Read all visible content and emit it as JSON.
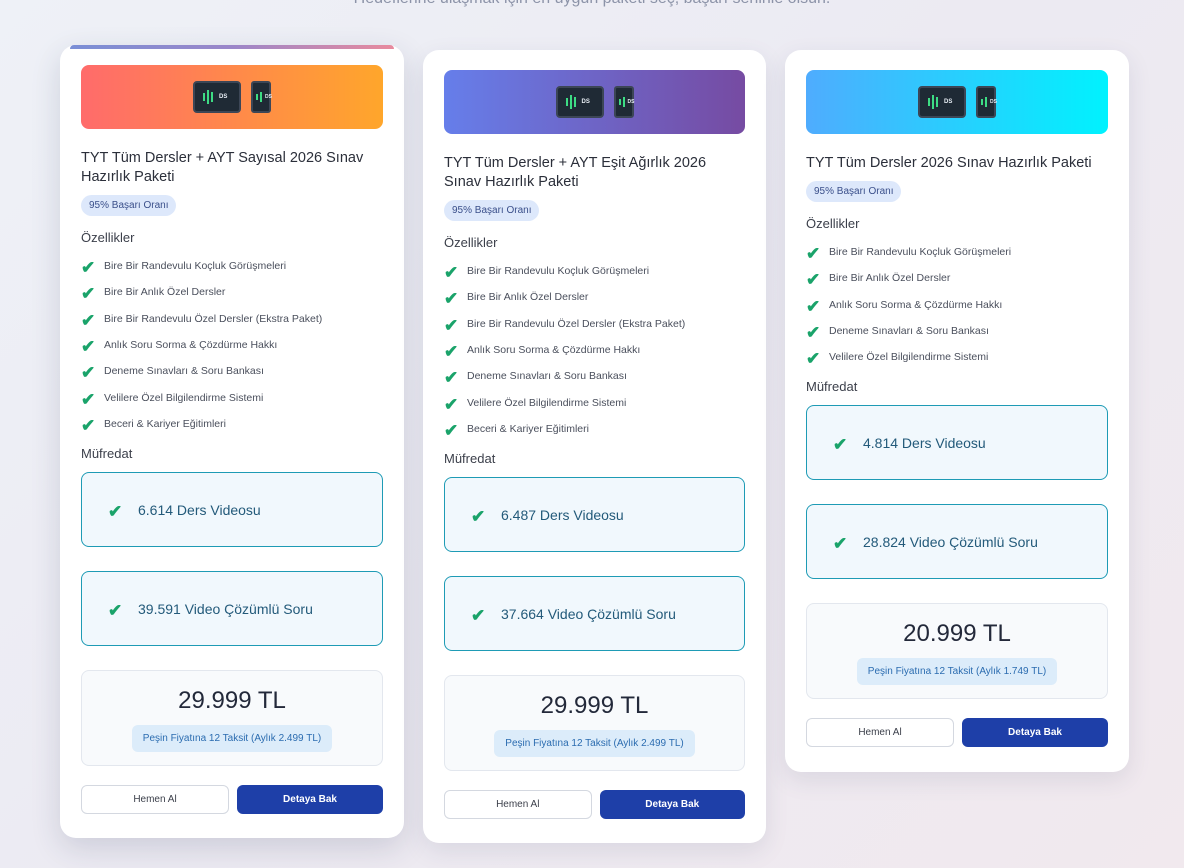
{
  "header": {
    "subtitle": "Hedeflerine ulaşmak için en uygun paketi seç, başarı seninle olsun."
  },
  "labels": {
    "features_heading": "Özellikler",
    "curriculum_heading": "Müfredat",
    "buy_button": "Hemen Al",
    "details_button": "Detaya Bak",
    "logo_text": "DS"
  },
  "colors": {
    "accent_button": "#1e3fa8",
    "check": "#1aa36a",
    "card1_banner": [
      "#ff6b6b",
      "#ffa62b"
    ],
    "card2_banner": [
      "#667eea",
      "#764ba2"
    ],
    "card3_banner": [
      "#4facfe",
      "#00f2fe"
    ]
  },
  "cards": [
    {
      "title": "TYT Tüm Dersler + AYT Sayısal 2026 Sınav Hazırlık Paketi",
      "badge": "95% Başarı Oranı",
      "features": [
        "Bire Bir Randevulu Koçluk Görüşmeleri",
        "Bire Bir Anlık Özel Dersler",
        "Bire Bir Randevulu Özel Dersler (Ekstra Paket)",
        "Anlık Soru Sorma & Çözdürme Hakkı",
        "Deneme Sınavları & Soru Bankası",
        "Velilere Özel Bilgilendirme Sistemi",
        "Beceri & Kariyer Eğitimleri"
      ],
      "curriculum": [
        "6.614 Ders Videosu",
        "39.591 Video Çözümlü Soru"
      ],
      "price": "29.999 TL",
      "installment": "Peşin Fiyatına 12 Taksit (Aylık 2.499 TL)"
    },
    {
      "title": "TYT Tüm Dersler + AYT Eşit Ağırlık 2026 Sınav Hazırlık Paketi",
      "badge": "95% Başarı Oranı",
      "features": [
        "Bire Bir Randevulu Koçluk Görüşmeleri",
        "Bire Bir Anlık Özel Dersler",
        "Bire Bir Randevulu Özel Dersler (Ekstra Paket)",
        "Anlık Soru Sorma & Çözdürme Hakkı",
        "Deneme Sınavları & Soru Bankası",
        "Velilere Özel Bilgilendirme Sistemi",
        "Beceri & Kariyer Eğitimleri"
      ],
      "curriculum": [
        "6.487 Ders Videosu",
        "37.664 Video Çözümlü Soru"
      ],
      "price": "29.999 TL",
      "installment": "Peşin Fiyatına 12 Taksit (Aylık 2.499 TL)"
    },
    {
      "title": "TYT Tüm Dersler 2026 Sınav Hazırlık Paketi",
      "badge": "95% Başarı Oranı",
      "features": [
        "Bire Bir Randevulu Koçluk Görüşmeleri",
        "Bire Bir Anlık Özel Dersler",
        "Anlık Soru Sorma & Çözdürme Hakkı",
        "Deneme Sınavları & Soru Bankası",
        "Velilere Özel Bilgilendirme Sistemi"
      ],
      "curriculum": [
        "4.814 Ders Videosu",
        "28.824 Video Çözümlü Soru"
      ],
      "price": "20.999 TL",
      "installment": "Peşin Fiyatına 12 Taksit (Aylık 1.749 TL)"
    }
  ]
}
